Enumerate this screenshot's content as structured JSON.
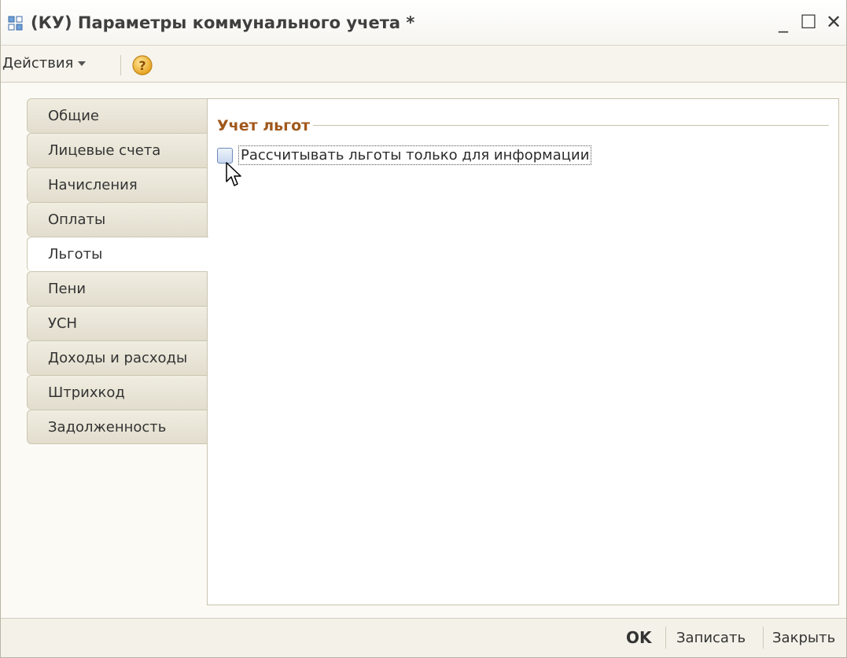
{
  "window": {
    "title": "(КУ) Параметры коммунального учета *",
    "minimize": "_",
    "maximize": "☐",
    "close": "✕"
  },
  "toolbar": {
    "actions_label": "Действия",
    "help_icon": "question-icon"
  },
  "tabs": [
    {
      "label": "Общие",
      "active": false
    },
    {
      "label": "Лицевые счета",
      "active": false
    },
    {
      "label": "Начисления",
      "active": false
    },
    {
      "label": "Оплаты",
      "active": false
    },
    {
      "label": "Льготы",
      "active": true
    },
    {
      "label": "Пени",
      "active": false
    },
    {
      "label": "УСН",
      "active": false
    },
    {
      "label": "Доходы и расходы",
      "active": false
    },
    {
      "label": "Штрихкод",
      "active": false
    },
    {
      "label": "Задолженность",
      "active": false
    }
  ],
  "panel": {
    "group_title": "Учет льгот",
    "checkbox_label": "Рассчитывать льготы только для информации",
    "checkbox_checked": false
  },
  "footer": {
    "ok_label": "OK",
    "save_label": "Записать",
    "close_label": "Закрыть"
  },
  "colors": {
    "group_title": "#a0581c",
    "checkbox_border": "#6d89b8"
  }
}
